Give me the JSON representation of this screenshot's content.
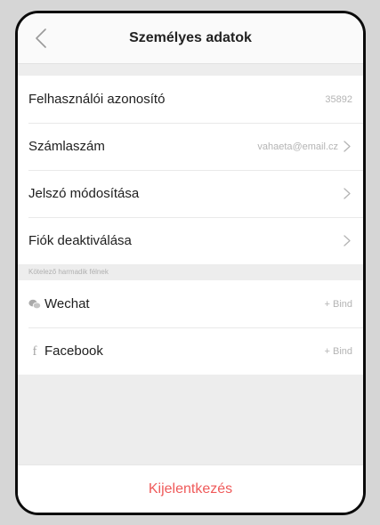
{
  "header": {
    "title": "Személyes adatok",
    "back_icon": "chevron-left-icon"
  },
  "account_rows": [
    {
      "label": "Felhasználói azonosító",
      "value": "35892",
      "has_chevron": false
    },
    {
      "label": "Számlaszám",
      "value": "vahaeta@email.cz",
      "has_chevron": true
    },
    {
      "label": "Jelszó módosítása",
      "value": "",
      "has_chevron": true
    },
    {
      "label": "Fiók deaktiválása",
      "value": "",
      "has_chevron": true
    }
  ],
  "third_party": {
    "section_label": "Kötelező harmadik félnek",
    "items": [
      {
        "label": "Wechat",
        "icon": "wechat-icon",
        "action": "+ Bind"
      },
      {
        "label": "Facebook",
        "icon": "facebook-icon",
        "action": "+ Bind"
      }
    ]
  },
  "logout": {
    "label": "Kijelentkezés",
    "color": "#ef5a5a"
  },
  "colors": {
    "background": "#ededed",
    "frame": "#0b0b0b",
    "muted_text": "#b4b4b4"
  }
}
